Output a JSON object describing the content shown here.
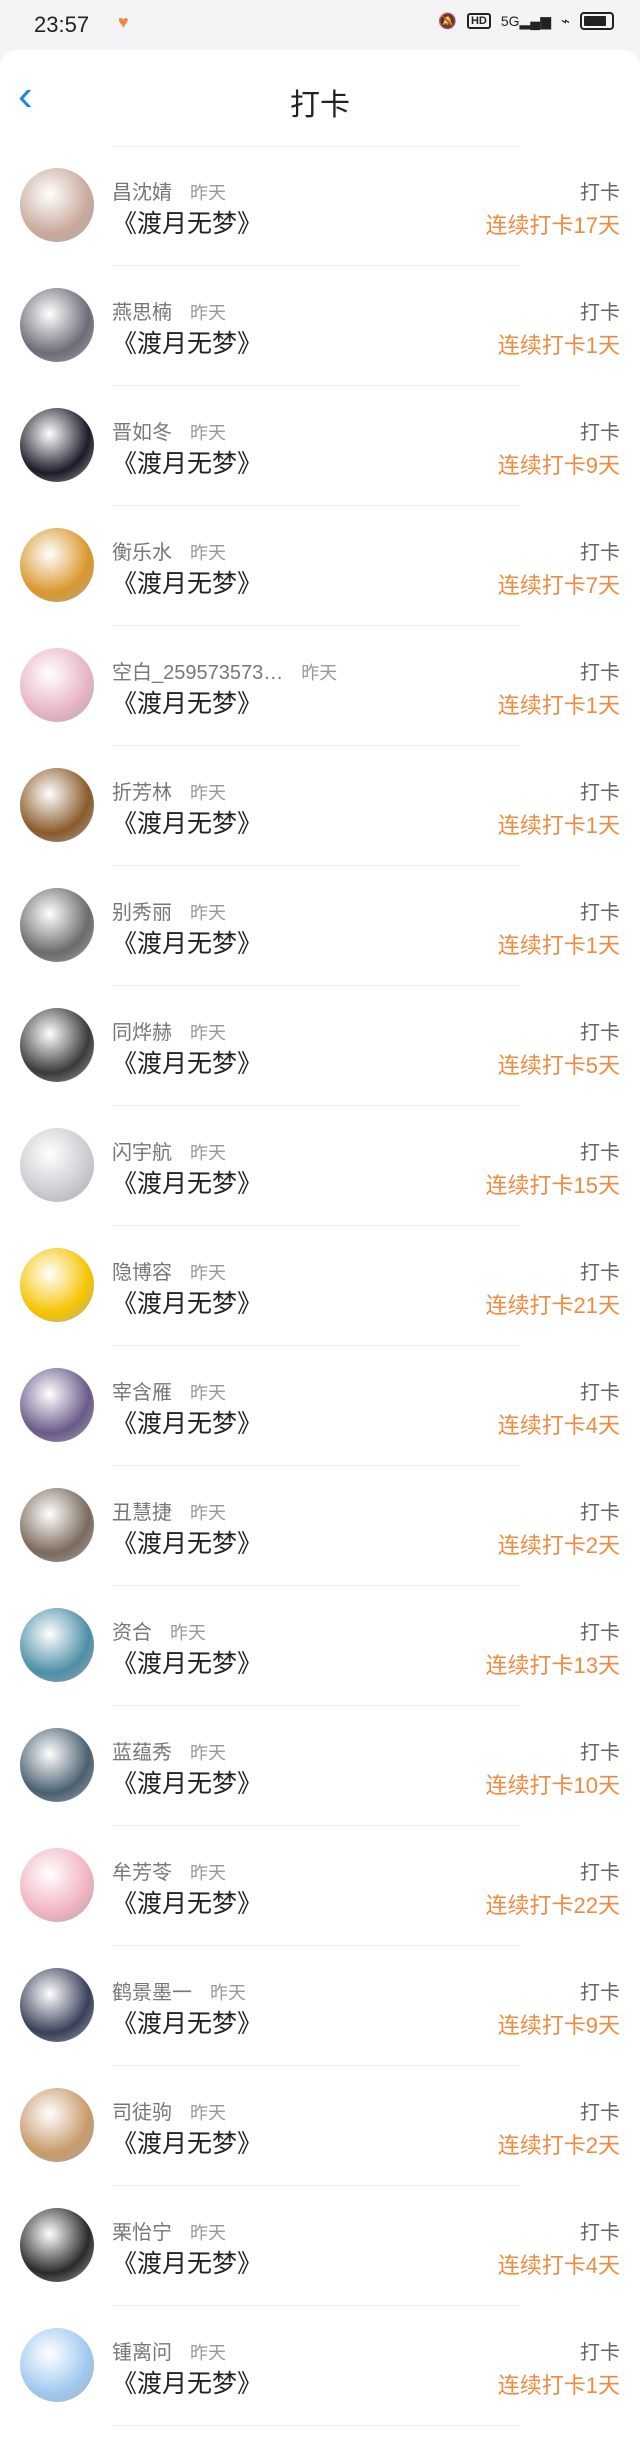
{
  "status_bar": {
    "time": "23:57",
    "heart_icon": "heart-icon",
    "hd_label": "HD",
    "network_label": "5G"
  },
  "header": {
    "title": "打卡"
  },
  "colors": {
    "accent": "#f08a3e",
    "back": "#1a8be0"
  },
  "items": [
    {
      "name": "昌沈婧",
      "time": "昨天",
      "book": "《渡月无梦》",
      "action": "打卡",
      "streak": "连续打卡17天",
      "avatar_color": "#c9a99c"
    },
    {
      "name": "燕思楠",
      "time": "昨天",
      "book": "《渡月无梦》",
      "action": "打卡",
      "streak": "连续打卡1天",
      "avatar_color": "#6f6a78"
    },
    {
      "name": "晋如冬",
      "time": "昨天",
      "book": "《渡月无梦》",
      "action": "打卡",
      "streak": "连续打卡9天",
      "avatar_color": "#1b1b2a"
    },
    {
      "name": "衡乐水",
      "time": "昨天",
      "book": "《渡月无梦》",
      "action": "打卡",
      "streak": "连续打卡7天",
      "avatar_color": "#d9972c"
    },
    {
      "name": "空白_259573573…",
      "time": "昨天",
      "book": "《渡月无梦》",
      "action": "打卡",
      "streak": "连续打卡1天",
      "avatar_color": "#e8b3c4"
    },
    {
      "name": "折芳林",
      "time": "昨天",
      "book": "《渡月无梦》",
      "action": "打卡",
      "streak": "连续打卡1天",
      "avatar_color": "#8a5a2a"
    },
    {
      "name": "别秀丽",
      "time": "昨天",
      "book": "《渡月无梦》",
      "action": "打卡",
      "streak": "连续打卡1天",
      "avatar_color": "#6b6b6b"
    },
    {
      "name": "同烨赫",
      "time": "昨天",
      "book": "《渡月无梦》",
      "action": "打卡",
      "streak": "连续打卡5天",
      "avatar_color": "#3a3a3a"
    },
    {
      "name": "闪宇航",
      "time": "昨天",
      "book": "《渡月无梦》",
      "action": "打卡",
      "streak": "连续打卡15天",
      "avatar_color": "#c9cbd0"
    },
    {
      "name": "隐博容",
      "time": "昨天",
      "book": "《渡月无梦》",
      "action": "打卡",
      "streak": "连续打卡21天",
      "avatar_color": "#f5c400"
    },
    {
      "name": "宰含雁",
      "time": "昨天",
      "book": "《渡月无梦》",
      "action": "打卡",
      "streak": "连续打卡4天",
      "avatar_color": "#6a5a8a"
    },
    {
      "name": "丑慧捷",
      "time": "昨天",
      "book": "《渡月无梦》",
      "action": "打卡",
      "streak": "连续打卡2天",
      "avatar_color": "#7b6a5c"
    },
    {
      "name": "资合",
      "time": "昨天",
      "book": "《渡月无梦》",
      "action": "打卡",
      "streak": "连续打卡13天",
      "avatar_color": "#4c8fa6"
    },
    {
      "name": "蓝蕴秀",
      "time": "昨天",
      "book": "《渡月无梦》",
      "action": "打卡",
      "streak": "连续打卡10天",
      "avatar_color": "#4a6070"
    },
    {
      "name": "牟芳苓",
      "time": "昨天",
      "book": "《渡月无梦》",
      "action": "打卡",
      "streak": "连续打卡22天",
      "avatar_color": "#f0b3c0"
    },
    {
      "name": "鹤景墨一",
      "time": "昨天",
      "book": "《渡月无梦》",
      "action": "打卡",
      "streak": "连续打卡9天",
      "avatar_color": "#3a3f5a"
    },
    {
      "name": "司徒驹",
      "time": "昨天",
      "book": "《渡月无梦》",
      "action": "打卡",
      "streak": "连续打卡2天",
      "avatar_color": "#c89a6a"
    },
    {
      "name": "栗怡宁",
      "time": "昨天",
      "book": "《渡月无梦》",
      "action": "打卡",
      "streak": "连续打卡4天",
      "avatar_color": "#2a2a2a"
    },
    {
      "name": "锺离问",
      "time": "昨天",
      "book": "《渡月无梦》",
      "action": "打卡",
      "streak": "连续打卡1天",
      "avatar_color": "#9fc9f0"
    }
  ]
}
